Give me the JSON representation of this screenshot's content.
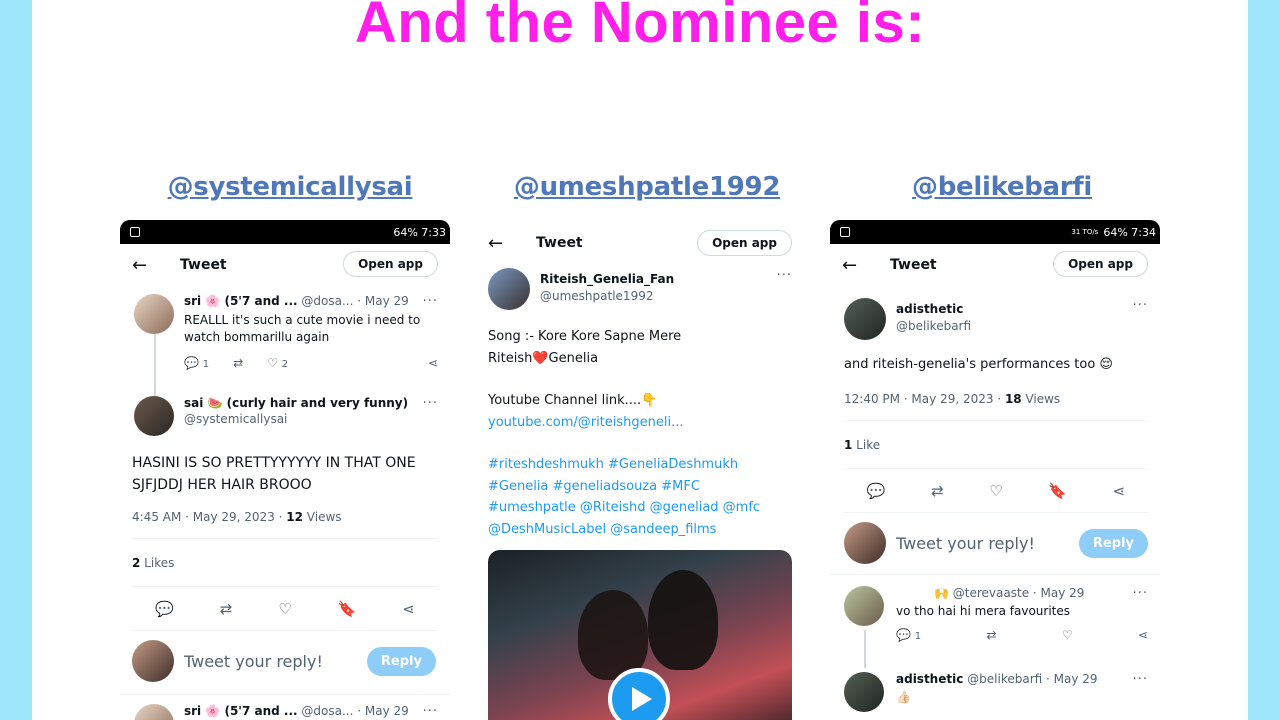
{
  "headline": "And the Nominee is:",
  "handles": [
    "@systemicallysai",
    "@umeshpatle1992",
    "@belikebarfi"
  ],
  "status": {
    "left_time": "64% 7:33",
    "right_time": "64% 7:34",
    "right_speed": "31 TO/s"
  },
  "shot1": {
    "back": "←",
    "title": "Tweet",
    "open_app": "Open app",
    "reply1": {
      "name": "sri 🌸 (5'7 and ...",
      "handle": "@dosa...",
      "date": "· May 29",
      "text": "REALLL it's such a cute movie i need to watch bommarillu again",
      "replies": "1",
      "likes": "2"
    },
    "main": {
      "name": "sai 🍉 (curly hair and very funny)",
      "handle": "@systemicallysai",
      "text": "HASINI IS SO PRETTYYYYYY IN THAT ONE SJFJDDJ HER HAIR BROOO",
      "time": "4:45 AM · May 29, 2023 · ",
      "views_count": "12",
      "views_label": " Views",
      "likes_count": "2",
      "likes_label": " Likes"
    },
    "reply_placeholder": "Tweet your reply!",
    "reply_button": "Reply",
    "reply2": {
      "name": "sri 🌸 (5'7 and ...",
      "handle": "@dosa...",
      "date": "· May 29"
    }
  },
  "shot2": {
    "back": "←",
    "title": "Tweet",
    "open_app": "Open app",
    "name": "Riteish_Genelia_Fan",
    "handle": "@umeshpatle1992",
    "line1": "Song :- Kore Kore Sapne Mere",
    "line2": "Riteish❤️Genelia",
    "line3": "Youtube Channel link....👇",
    "link": "youtube.com/@riteishgeneli...",
    "tags1": "#riteshdeshmukh #GeneliaDeshmukh",
    "tags2": "#Genelia #geneliadsouza #MFC",
    "tags3": "#umeshpatle @Riteishd @geneliad @mfc",
    "tags4": "@DeshMusicLabel @sandeep_films"
  },
  "shot3": {
    "back": "←",
    "title": "Tweet",
    "open_app": "Open app",
    "name": "adisthetic",
    "handle": "@belikebarfi",
    "text": "and riteish-genelia's performances too 😌",
    "time": "12:40 PM · May 29, 2023 · ",
    "views_count": "18",
    "views_label": " Views",
    "likes_count": "1",
    "likes_label": " Like",
    "reply_placeholder": "Tweet your reply!",
    "reply_button": "Reply",
    "reply1": {
      "name": "🙌",
      "handle": "@terevaaste · May 29",
      "text": "vo tho hai hi mera favourites",
      "replies": "1"
    },
    "reply2": {
      "name": "adisthetic",
      "handle": "@belikebarfi · May 29",
      "text": "👍🏻"
    }
  },
  "icons": {
    "reply": "reply-icon",
    "retweet": "retweet-icon",
    "like": "heart-icon",
    "bookmark": "bookmark-icon",
    "share": "share-icon"
  },
  "colors": {
    "background": "#9ee7fb",
    "headline": "#ff1eea",
    "handle": "#4e78b9",
    "link": "#1d9bf0",
    "reply_button": "#8ecdf8"
  }
}
